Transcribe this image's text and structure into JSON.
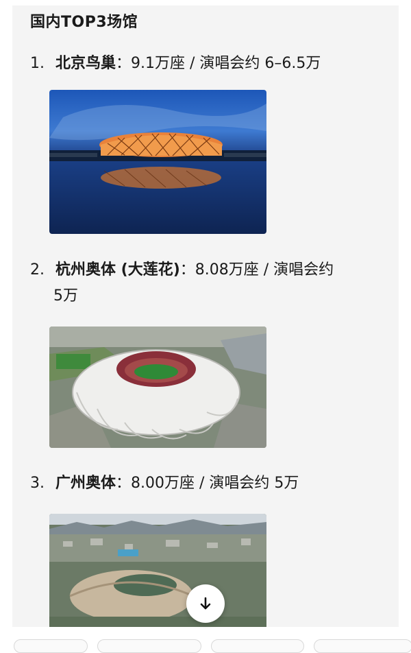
{
  "section": {
    "title": "国内TOP3场馆"
  },
  "venues": [
    {
      "number": "1.",
      "name": "北京鸟巢",
      "detail": "：9.1万座 / 演唱会约 6–6.5万",
      "photo_icon": "birds-nest-stadium-photo"
    },
    {
      "number": "2.",
      "name": "杭州奥体 (大莲花)",
      "detail": "：8.08万座 / 演唱会约",
      "detail_cont": "5万",
      "photo_icon": "lotus-stadium-photo"
    },
    {
      "number": "3.",
      "name": "广州奥体",
      "detail": "：8.00万座 / 演唱会约 5万",
      "photo_icon": "guangzhou-stadium-photo"
    }
  ],
  "scroll_button": {
    "icon": "arrow-down-icon"
  },
  "chips": {
    "count_visible": 4
  }
}
